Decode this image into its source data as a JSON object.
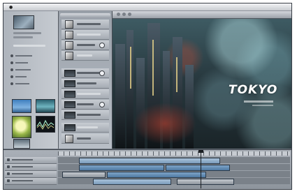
{
  "viewer": {
    "title_overlay": "TOKYO"
  },
  "colors": {
    "window_chrome": "#6e7680",
    "timeline_clip": "#4f7aa3",
    "title_text": "#ffffff"
  },
  "icons": {
    "menu_logo": "apple-icon",
    "playhead": "playhead-icon"
  }
}
